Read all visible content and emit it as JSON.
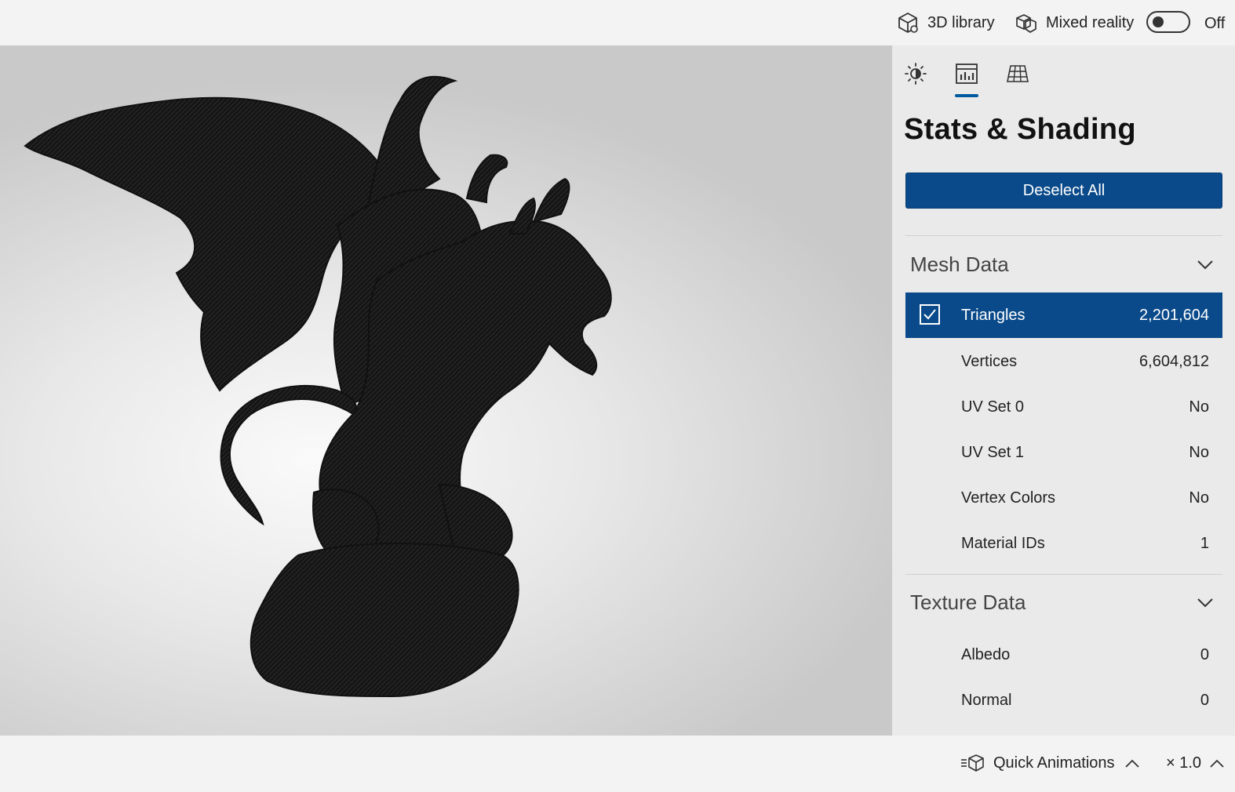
{
  "topbar": {
    "library_label": "3D library",
    "library_icon": "cube-icon",
    "mixed_reality_label": "Mixed reality",
    "mixed_reality_icon": "mixed-reality-icon",
    "mixed_reality_state": "Off"
  },
  "panel": {
    "tabs": [
      {
        "icon": "sun-icon",
        "selected": false
      },
      {
        "icon": "stats-icon",
        "selected": true
      },
      {
        "icon": "grid-icon",
        "selected": false
      }
    ],
    "title": "Stats & Shading",
    "deselect_label": "Deselect All",
    "accent_color": "#0a4a8a",
    "sections": [
      {
        "label": "Mesh Data",
        "rows": [
          {
            "name": "Triangles",
            "value": "2,201,604",
            "selected": true
          },
          {
            "name": "Vertices",
            "value": "6,604,812"
          },
          {
            "name": "UV Set 0",
            "value": "No"
          },
          {
            "name": "UV Set 1",
            "value": "No"
          },
          {
            "name": "Vertex Colors",
            "value": "No"
          },
          {
            "name": "Material IDs",
            "value": "1"
          }
        ]
      },
      {
        "label": "Texture Data",
        "rows": [
          {
            "name": "Albedo",
            "value": "0"
          },
          {
            "name": "Normal",
            "value": "0"
          }
        ]
      }
    ]
  },
  "bottombar": {
    "animations_label": "Quick Animations",
    "animations_icon": "animation-cube-icon",
    "speed_label": "× 1.0"
  }
}
